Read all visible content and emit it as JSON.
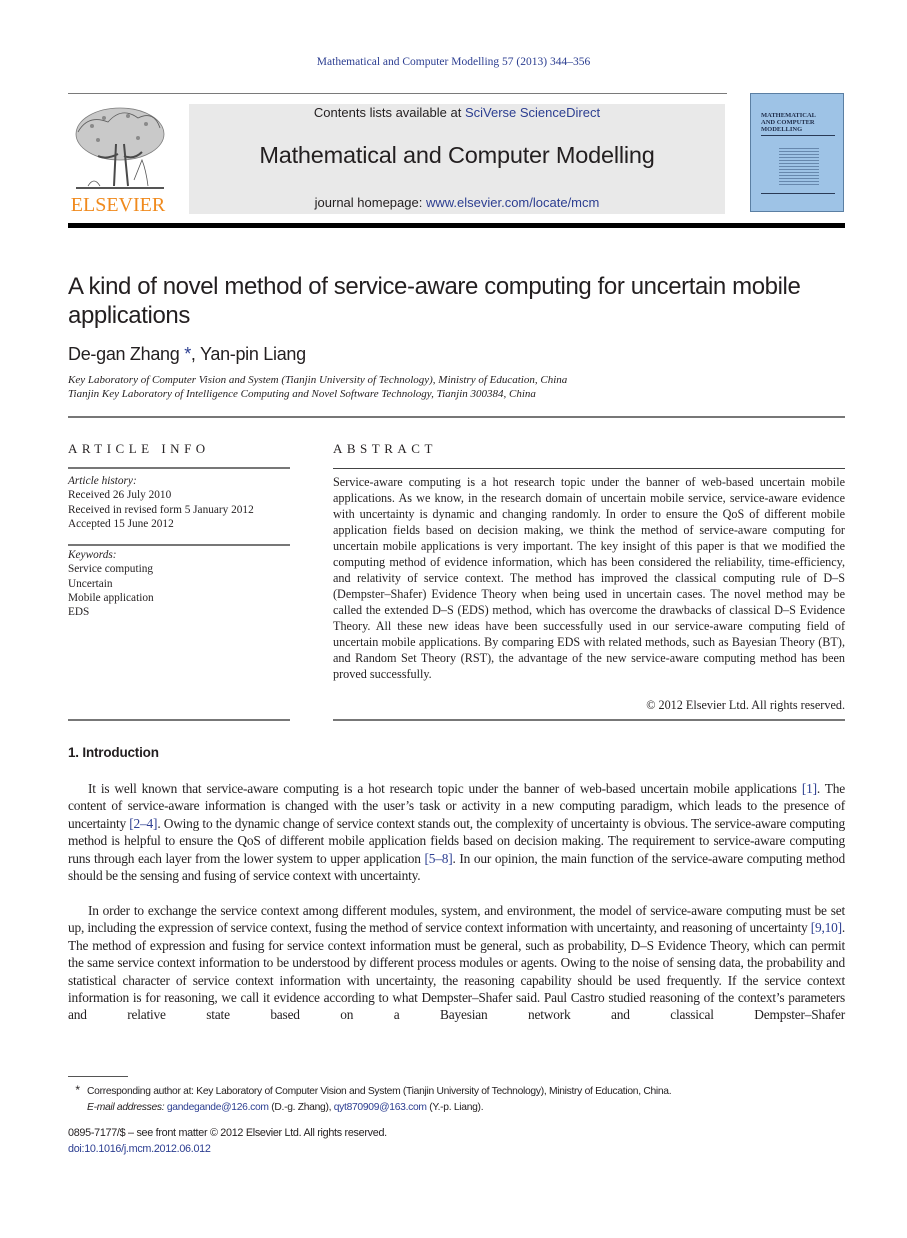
{
  "running_header": "Mathematical and Computer Modelling 57 (2013) 344–356",
  "masthead": {
    "publisher_logo_text": "ELSEVIER",
    "contents_prefix": "Contents lists available at ",
    "contents_link": "SciVerse ScienceDirect",
    "journal_name": "Mathematical and Computer Modelling",
    "homepage_prefix": "journal homepage: ",
    "homepage_link": "www.elsevier.com/locate/mcm",
    "cover_title_lines": [
      "MATHEMATICAL",
      "AND COMPUTER",
      "MODELLING"
    ]
  },
  "article": {
    "title": "A kind of novel method of service-aware computing for uncertain mobile applications",
    "authors": [
      {
        "name": "De-gan Zhang",
        "corresponding_mark": "*"
      },
      {
        "name": "Yan-pin Liang"
      }
    ],
    "author_separator": ", ",
    "affiliations": [
      "Key Laboratory of Computer Vision and System (Tianjin University of Technology), Ministry of Education, China",
      "Tianjin Key Laboratory of Intelligence Computing and Novel Software Technology, Tianjin 300384, China"
    ]
  },
  "article_info": {
    "heading": "ARTICLE INFO",
    "history_label": "Article history:",
    "history": [
      "Received 26 July 2010",
      "Received in revised form 5 January 2012",
      "Accepted 15 June 2012"
    ],
    "keywords_label": "Keywords:",
    "keywords": [
      "Service computing",
      "Uncertain",
      "Mobile application",
      "EDS"
    ]
  },
  "abstract": {
    "heading": "ABSTRACT",
    "text": "Service-aware computing is a hot research topic under the banner of web-based uncertain mobile applications. As we know, in the research domain of uncertain mobile service, service-aware evidence with uncertainty is dynamic and changing randomly. In order to ensure the QoS of different mobile application fields based on decision making, we think the method of service-aware computing for uncertain mobile applications is very important. The key insight of this paper is that we modified the computing method of evidence information, which has been considered the reliability, time-efficiency, and relativity of service context. The method has improved the classical computing rule of D–S (Dempster–Shafer) Evidence Theory when being used in uncertain cases. The novel method may be called the extended D–S (EDS) method, which has overcome the drawbacks of classical D–S Evidence Theory. All these new ideas have been successfully used in our service-aware computing field of uncertain mobile applications. By comparing EDS with related methods, such as Bayesian Theory (BT), and Random Set Theory (RST), the advantage of the new service-aware computing method has been proved successfully.",
    "copyright": "© 2012 Elsevier Ltd. All rights reserved."
  },
  "introduction": {
    "heading": "1.  Introduction",
    "paragraphs": [
      [
        {
          "t": "It is well known that service-aware computing is a hot research topic under the banner of web-based uncertain mobile applications "
        },
        {
          "ref": "[1]"
        },
        {
          "t": ". The content of service-aware information is changed with the user’s task or activity in a new computing paradigm, which leads to the presence of uncertainty "
        },
        {
          "ref": "[2–4]"
        },
        {
          "t": ". Owing to the dynamic change of service context stands out, the complexity of uncertainty is obvious. The service-aware computing method is helpful to ensure the QoS of different mobile application fields based on decision making. The requirement to service-aware computing runs through each layer from the lower system to upper application "
        },
        {
          "ref": "[5–8]"
        },
        {
          "t": ". In our opinion, the main function of the service-aware computing method should be the sensing and fusing of service context with uncertainty."
        }
      ],
      [
        {
          "t": "In order to exchange the service context among different modules, system, and environment, the model of service-aware computing must be set up, including the expression of service context, fusing the method of service context information with uncertainty, and reasoning of uncertainty "
        },
        {
          "ref": "[9,10]"
        },
        {
          "t": ". The method of expression and fusing for service context information must be general, such as probability, D–S Evidence Theory, which can permit the same service context information to be understood by different process modules or agents. Owing to the noise of sensing data, the probability and statistical character of service context information with uncertainty, the reasoning capability should be used frequently. If the service context information is for reasoning, we call it evidence according to what Dempster–Shafer said. Paul Castro studied reasoning of the context’s parameters and relative state based on a Bayesian network and classical Dempster–Shafer"
        }
      ]
    ]
  },
  "footnote": {
    "mark": "*",
    "corresponding": "Corresponding author at: Key Laboratory of Computer Vision and System (Tianjin University of Technology), Ministry of Education, China.",
    "email_label": "E-mail addresses:",
    "emails": [
      {
        "address": "gandegande@126.com",
        "owner": "(D.-g. Zhang)"
      },
      {
        "address": "qyt870909@163.com",
        "owner": "(Y.-p. Liang)"
      }
    ]
  },
  "front_matter": {
    "issn_line": "0895-7177/$ – see front matter © 2012 Elsevier Ltd. All rights reserved.",
    "doi": "doi:10.1016/j.mcm.2012.06.012"
  },
  "colors": {
    "link": "#2c3e91",
    "elsevier_orange": "#f08a1d",
    "masthead_band": "#e9e9e9",
    "cover_blue": "#9ec3e6"
  }
}
